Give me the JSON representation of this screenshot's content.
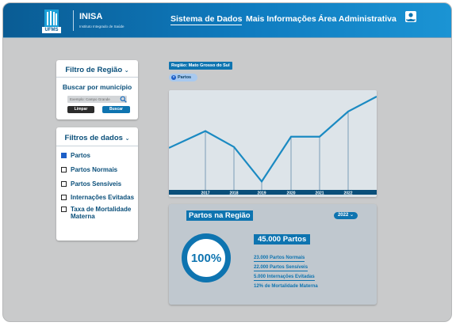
{
  "header": {
    "logo_text": "UFMS",
    "brand_name": "INISA",
    "brand_subtitle": "Instituto Integrado de Saúde",
    "nav": [
      {
        "label": "Sistema de Dados"
      },
      {
        "label": "Mais Informações"
      },
      {
        "label": "Área Administrativa"
      }
    ]
  },
  "region_filter": {
    "title": "Filtro de Região",
    "subtitle": "Buscar por município",
    "search_placeholder": "Exemplo: Campo Grande",
    "clear_label": "Limpar",
    "search_label": "Buscar"
  },
  "data_filters": {
    "title": "Filtros de dados",
    "items": [
      {
        "label": "Partos",
        "checked": true
      },
      {
        "label": "Partos Normais",
        "checked": false
      },
      {
        "label": "Partos Sensíveis",
        "checked": false
      },
      {
        "label": "Internações Evitadas",
        "checked": false
      },
      {
        "label": "Taxa de Mortalidade Materna",
        "checked": false
      }
    ]
  },
  "active_region": "Região: Mato Grosso do Sul",
  "active_chip": "Partos",
  "chart_data": {
    "type": "line",
    "categories": [
      "2017",
      "2018",
      "2019",
      "2020",
      "2021",
      "2022"
    ],
    "values": [
      63,
      46,
      9,
      57,
      57,
      84
    ],
    "ylim": [
      0,
      100
    ],
    "grid": false,
    "color": "#1b8ac2"
  },
  "stats": {
    "title": "Partos na Região",
    "year": "2022",
    "percent": "100%",
    "total": "45.000 Partos",
    "lines": [
      "23.000 Partos Normais",
      "22.000 Partos Sensíveis",
      "5.000 Internações Evitadas",
      "12% de Mortalidade Materna"
    ]
  },
  "colors": {
    "primary": "#0e74b0",
    "header_dark": "#0a5c94",
    "title_text": "#0a4f7a",
    "checkbox_checked": "#1d5fc8",
    "background": "#c9cacb"
  }
}
